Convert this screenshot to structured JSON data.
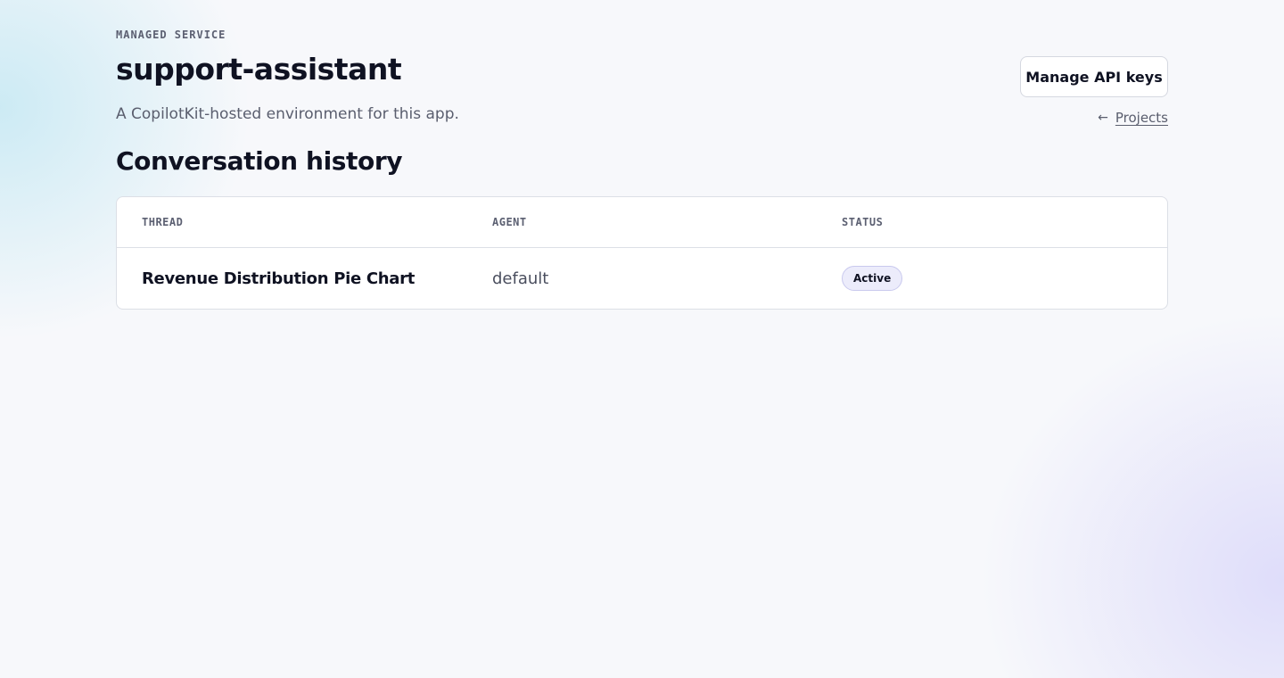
{
  "header": {
    "eyebrow": "MANAGED SERVICE",
    "title": "support-assistant",
    "subtitle": "A CopilotKit-hosted environment for this app.",
    "manage_button_label": "Manage API keys",
    "back_link": {
      "icon": "arrow-left-icon",
      "label": "Projects"
    }
  },
  "section": {
    "title": "Conversation history"
  },
  "table": {
    "columns": [
      "THREAD",
      "AGENT",
      "STATUS"
    ],
    "rows": [
      {
        "thread": "Revenue Distribution Pie Chart",
        "agent": "default",
        "status": "Active"
      }
    ]
  },
  "colors": {
    "background": "#f7f8fb",
    "text_primary": "#0f1222",
    "text_muted": "#5a5e6e",
    "badge_bg": "#ececfb",
    "badge_border": "#c9c9ee"
  }
}
